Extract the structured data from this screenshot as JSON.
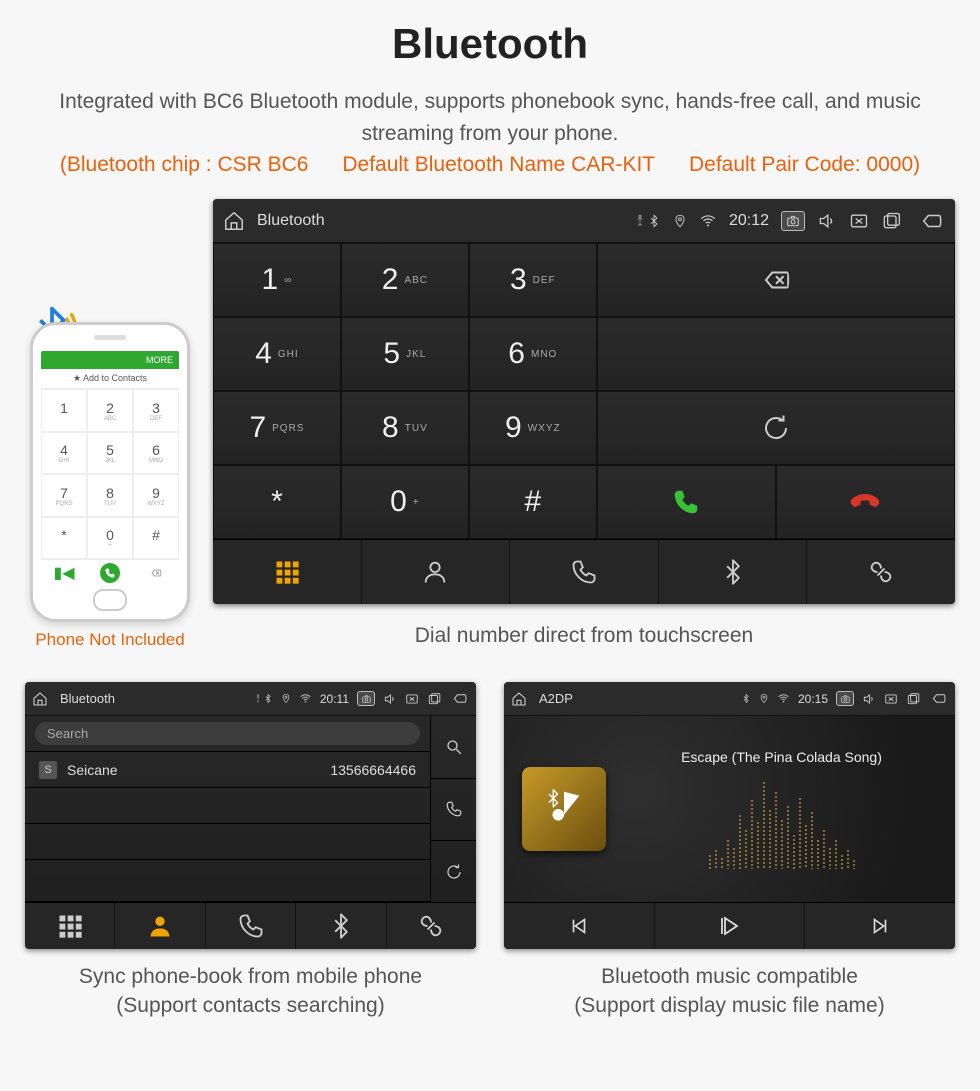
{
  "heading": "Bluetooth",
  "description": "Integrated with BC6 Bluetooth module, supports phonebook sync, hands-free call, and music streaming from your phone.",
  "specs": {
    "chip": "(Bluetooth chip : CSR BC6",
    "name": "Default Bluetooth Name CAR-KIT",
    "code": "Default Pair Code: 0000)"
  },
  "phone_not_included": "Phone Not Included",
  "phone_mock": {
    "header_more": "MORE",
    "add_to_contacts": "Add to Contacts",
    "keys": [
      {
        "n": "1",
        "s": ""
      },
      {
        "n": "2",
        "s": "ABC"
      },
      {
        "n": "3",
        "s": "DEF"
      },
      {
        "n": "4",
        "s": "GHI"
      },
      {
        "n": "5",
        "s": "JKL"
      },
      {
        "n": "6",
        "s": "MNO"
      },
      {
        "n": "7",
        "s": "PQRS"
      },
      {
        "n": "8",
        "s": "TUV"
      },
      {
        "n": "9",
        "s": "WXYZ"
      },
      {
        "n": "*",
        "s": ""
      },
      {
        "n": "0",
        "s": "+"
      },
      {
        "n": "#",
        "s": ""
      }
    ]
  },
  "dialer": {
    "status": {
      "title": "Bluetooth",
      "time": "20:12"
    },
    "keys": [
      {
        "n": "1",
        "s": "∞"
      },
      {
        "n": "2",
        "s": "ABC"
      },
      {
        "n": "3",
        "s": "DEF"
      },
      {
        "n": "4",
        "s": "GHI"
      },
      {
        "n": "5",
        "s": "JKL"
      },
      {
        "n": "6",
        "s": "MNO"
      },
      {
        "n": "7",
        "s": "PQRS"
      },
      {
        "n": "8",
        "s": "TUV"
      },
      {
        "n": "9",
        "s": "WXYZ"
      },
      {
        "n": "*",
        "s": ""
      },
      {
        "n": "0",
        "s": "+"
      },
      {
        "n": "#",
        "s": ""
      }
    ],
    "caption": "Dial number direct from touchscreen"
  },
  "contacts": {
    "status": {
      "title": "Bluetooth",
      "time": "20:11"
    },
    "search_placeholder": "Search",
    "rows": [
      {
        "badge": "S",
        "name": "Seicane",
        "number": "13566664466"
      }
    ],
    "caption_line1": "Sync phone-book from mobile phone",
    "caption_line2": "(Support contacts searching)"
  },
  "music": {
    "status": {
      "title": "A2DP",
      "time": "20:15"
    },
    "song": "Escape (The Pina Colada Song)",
    "caption_line1": "Bluetooth music compatible",
    "caption_line2": "(Support display music file name)"
  }
}
